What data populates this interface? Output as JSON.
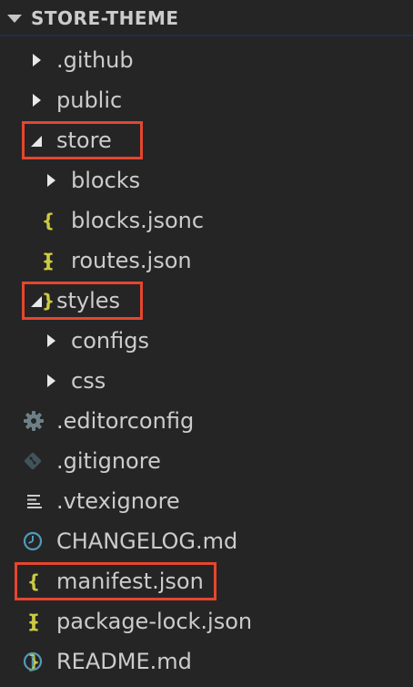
{
  "explorer": {
    "title": "STORE-THEME"
  },
  "tree": {
    "github": ".github",
    "public": "public",
    "store": "store",
    "blocks_folder": "blocks",
    "blocks_jsonc": "blocks.jsonc",
    "routes_json": "routes.json",
    "styles": "styles",
    "configs": "configs",
    "css": "css",
    "editorconfig": ".editorconfig",
    "gitignore": ".gitignore",
    "vtexignore": ".vtexignore",
    "changelog": "CHANGELOG.md",
    "manifest": "manifest.json",
    "package_lock": "package-lock.json",
    "readme": "README.md"
  },
  "icons": {
    "json": "{ }",
    "json_color": "#cbcb41",
    "gear_color": "#6d8086",
    "git_color": "#41535b",
    "clock_color": "#519aba",
    "info_color": "#519aba"
  },
  "highlight_color": "#e5462f"
}
